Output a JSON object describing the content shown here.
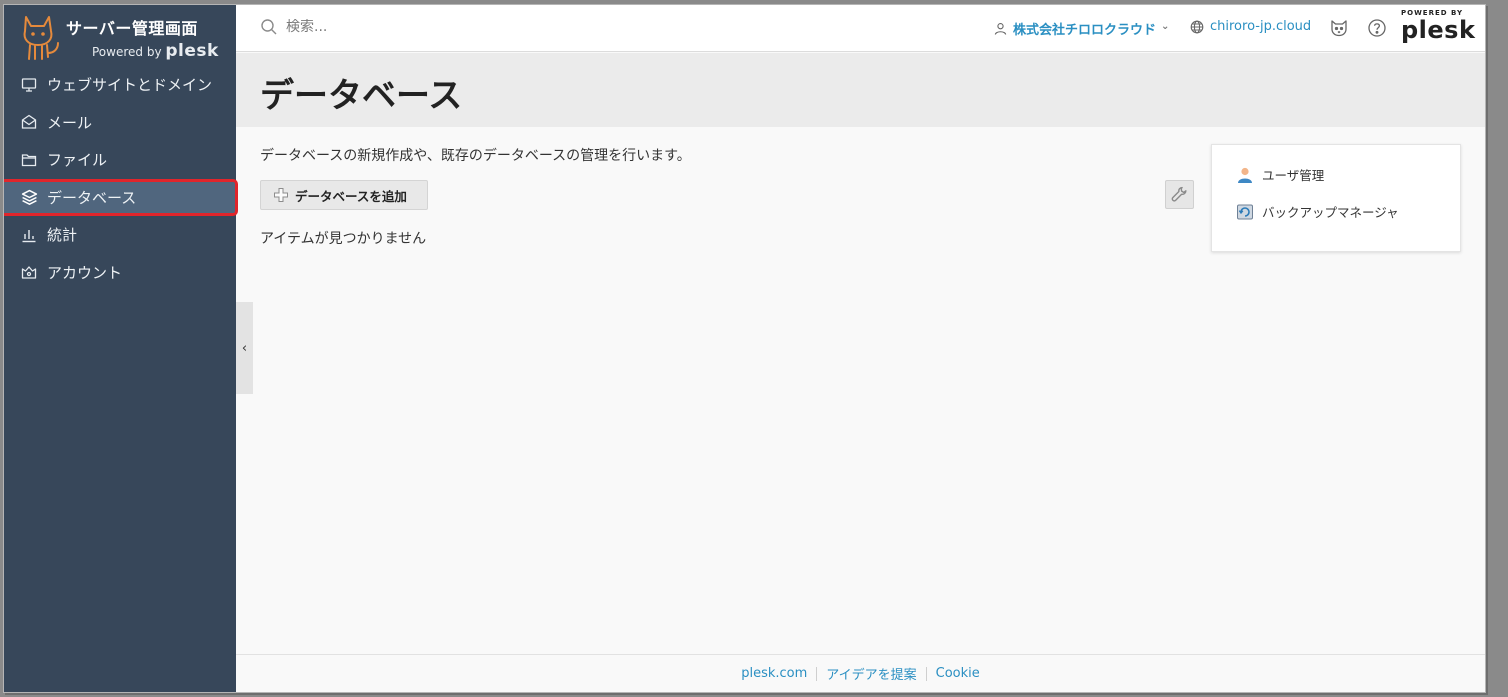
{
  "brand": {
    "title": "サーバー管理画面",
    "powered_prefix": "Powered by",
    "powered_name": "plesk"
  },
  "sidebar": {
    "items": [
      {
        "label": "ウェブサイトとドメイン",
        "icon": "monitor-icon"
      },
      {
        "label": "メール",
        "icon": "mail-icon"
      },
      {
        "label": "ファイル",
        "icon": "folder-icon"
      },
      {
        "label": "データベース",
        "icon": "database-layers-icon",
        "active": true
      },
      {
        "label": "統計",
        "icon": "bar-chart-icon"
      },
      {
        "label": "アカウント",
        "icon": "account-icon"
      }
    ],
    "collapse_glyph": "‹"
  },
  "header": {
    "search_placeholder": "検索...",
    "company": "株式会社チロロクラウド",
    "company_chevron": "⌄",
    "domain": "chiroro-jp.cloud",
    "powered_badge_top": "POWERED BY",
    "powered_badge_name": "plesk"
  },
  "page": {
    "title": "データベース",
    "description": "データベースの新規作成や、既存のデータベースの管理を行います。",
    "add_button": "データベースを追加",
    "empty_message": "アイテムが見つかりません"
  },
  "panel": {
    "items": [
      {
        "label": "ユーザ管理",
        "icon": "user-icon"
      },
      {
        "label": "バックアップマネージャ",
        "icon": "backup-icon"
      }
    ]
  },
  "footer": {
    "links": [
      "plesk.com",
      "アイデアを提案",
      "Cookie"
    ]
  },
  "colors": {
    "sidebar_bg": "#37475a",
    "active_bg": "#50667e",
    "highlight_border": "#e1252b",
    "link": "#2a8fc2"
  }
}
